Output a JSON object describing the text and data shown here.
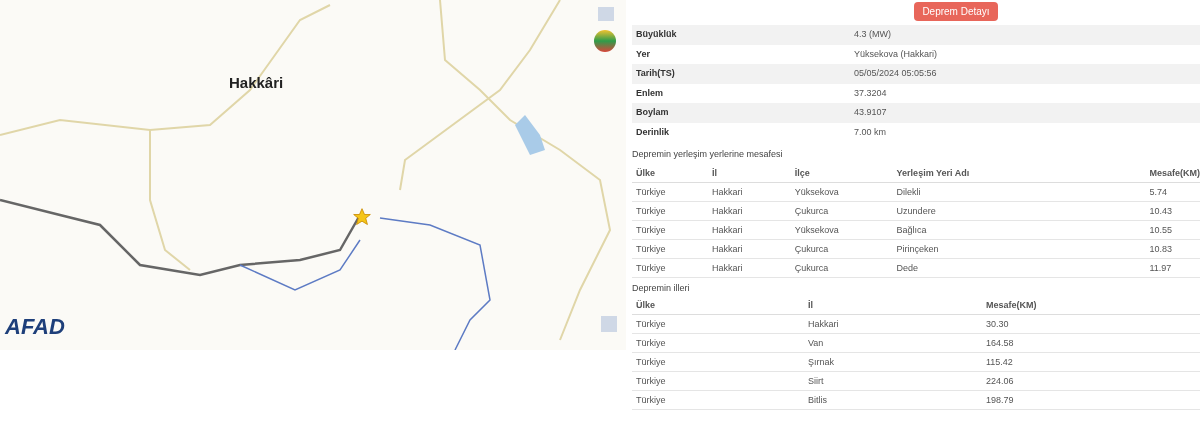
{
  "map": {
    "city_label": "Hakkâri",
    "logo": "AFAD"
  },
  "report_button": "Deprem Detayı",
  "details": [
    {
      "label": "Büyüklük",
      "value": "4.3 (MW)"
    },
    {
      "label": "Yer",
      "value": "Yüksekova (Hakkari)"
    },
    {
      "label": "Tarih(TS)",
      "value": "05/05/2024 05:05:56"
    },
    {
      "label": "Enlem",
      "value": "37.3204"
    },
    {
      "label": "Boylam",
      "value": "43.9107"
    },
    {
      "label": "Derinlik",
      "value": "7.00 km"
    }
  ],
  "settlements": {
    "title": "Depremin yerleşim yerlerine mesafesi",
    "columns": [
      "Ülke",
      "İl",
      "İlçe",
      "Yerleşim Yeri Adı",
      "Mesafe(KM)"
    ],
    "rows": [
      [
        "Türkiye",
        "Hakkari",
        "Yüksekova",
        "Dilekli",
        "5.74"
      ],
      [
        "Türkiye",
        "Hakkari",
        "Çukurca",
        "Uzundere",
        "10.43"
      ],
      [
        "Türkiye",
        "Hakkari",
        "Yüksekova",
        "Bağlıca",
        "10.55"
      ],
      [
        "Türkiye",
        "Hakkari",
        "Çukurca",
        "Pirinçeken",
        "10.83"
      ],
      [
        "Türkiye",
        "Hakkari",
        "Çukurca",
        "Dede",
        "11.97"
      ]
    ]
  },
  "provinces": {
    "title": "Depremin illeri",
    "columns": [
      "Ülke",
      "İl",
      "Mesafe(KM)"
    ],
    "rows": [
      [
        "Türkiye",
        "Hakkari",
        "30.30"
      ],
      [
        "Türkiye",
        "Van",
        "164.58"
      ],
      [
        "Türkiye",
        "Şırnak",
        "115.42"
      ],
      [
        "Türkiye",
        "Siirt",
        "224.06"
      ],
      [
        "Türkiye",
        "Bitlis",
        "198.79"
      ]
    ]
  }
}
